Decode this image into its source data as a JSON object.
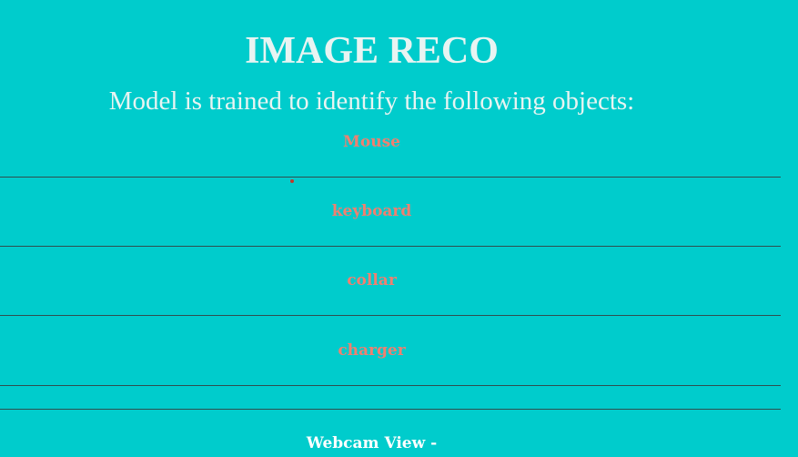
{
  "header": {
    "title": "IMAGE RECO",
    "subtitle": "Model is trained to identify the following objects:"
  },
  "objects": [
    {
      "label": "Mouse"
    },
    {
      "label": "keyboard"
    },
    {
      "label": "collar"
    },
    {
      "label": "charger"
    }
  ],
  "webcam": {
    "label": "Webcam View -"
  },
  "colors": {
    "background": "#00CCCC",
    "heading_text": "#E8F4F2",
    "object_text": "#F08070",
    "webcam_text": "#FFFFFF",
    "divider": "#2F4F4F",
    "bullet": "#C0392B"
  }
}
